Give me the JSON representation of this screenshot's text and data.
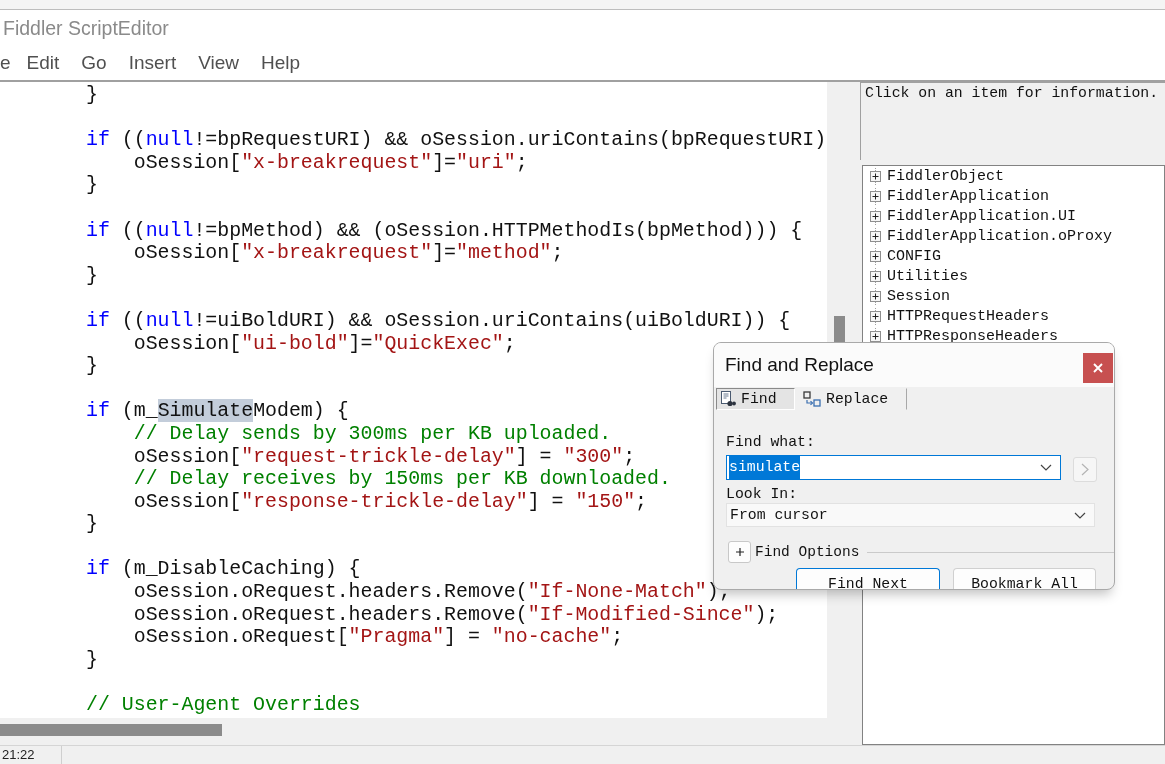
{
  "window": {
    "title": "Fiddler ScriptEditor"
  },
  "menu": [
    "e",
    "Edit",
    "Go",
    "Insert",
    "View",
    "Help"
  ],
  "editor": {
    "blocks": [
      {
        "lines": [
          {
            "tokens": [
              {
                "kind": "plain",
                "text": "}"
              }
            ]
          }
        ]
      },
      {
        "lines": [
          {
            "tokens": [
              {
                "kind": "keyword",
                "text": "if"
              },
              {
                "kind": "plain",
                "text": " (("
              },
              {
                "kind": "keyword",
                "text": "null"
              },
              {
                "kind": "plain",
                "text": "!=bpRequestURI) && oSession.uriContains(bpRequestURI)"
              }
            ],
            "children": [
              {
                "tokens": [
                  {
                    "kind": "plain",
                    "text": "oSession["
                  },
                  {
                    "kind": "string",
                    "text": "\"x-breakrequest\""
                  },
                  {
                    "kind": "plain",
                    "text": "]="
                  },
                  {
                    "kind": "string",
                    "text": "\"uri\""
                  },
                  {
                    "kind": "plain",
                    "text": ";"
                  }
                ]
              }
            ]
          },
          {
            "tokens": [
              {
                "kind": "plain",
                "text": "}"
              }
            ]
          }
        ]
      },
      {
        "lines": [
          {
            "tokens": [
              {
                "kind": "keyword",
                "text": "if"
              },
              {
                "kind": "plain",
                "text": " (("
              },
              {
                "kind": "keyword",
                "text": "null"
              },
              {
                "kind": "plain",
                "text": "!=bpMethod) && (oSession.HTTPMethodIs(bpMethod))) {"
              }
            ],
            "children": [
              {
                "tokens": [
                  {
                    "kind": "plain",
                    "text": "oSession["
                  },
                  {
                    "kind": "string",
                    "text": "\"x-breakrequest\""
                  },
                  {
                    "kind": "plain",
                    "text": "]="
                  },
                  {
                    "kind": "string",
                    "text": "\"method\""
                  },
                  {
                    "kind": "plain",
                    "text": ";"
                  }
                ]
              }
            ]
          },
          {
            "tokens": [
              {
                "kind": "plain",
                "text": "}"
              }
            ]
          }
        ]
      },
      {
        "lines": [
          {
            "tokens": [
              {
                "kind": "keyword",
                "text": "if"
              },
              {
                "kind": "plain",
                "text": " (("
              },
              {
                "kind": "keyword",
                "text": "null"
              },
              {
                "kind": "plain",
                "text": "!=uiBoldURI) && oSession.uriContains(uiBoldURI)) {"
              }
            ],
            "children": [
              {
                "tokens": [
                  {
                    "kind": "plain",
                    "text": "oSession["
                  },
                  {
                    "kind": "string",
                    "text": "\"ui-bold\""
                  },
                  {
                    "kind": "plain",
                    "text": "]="
                  },
                  {
                    "kind": "string",
                    "text": "\"QuickExec\""
                  },
                  {
                    "kind": "plain",
                    "text": ";"
                  }
                ]
              }
            ]
          },
          {
            "tokens": [
              {
                "kind": "plain",
                "text": "}"
              }
            ]
          }
        ]
      },
      {
        "lines": [
          {
            "tokens": [
              {
                "kind": "keyword",
                "text": "if"
              },
              {
                "kind": "plain",
                "text": " (m_"
              },
              {
                "kind": "match",
                "text": "Simulate"
              },
              {
                "kind": "plain",
                "text": "Modem) {"
              }
            ],
            "children": [
              {
                "tokens": [
                  {
                    "kind": "comment",
                    "text": "// Delay sends by 300ms per KB uploaded."
                  }
                ]
              },
              {
                "tokens": [
                  {
                    "kind": "plain",
                    "text": "oSession["
                  },
                  {
                    "kind": "string",
                    "text": "\"request-trickle-delay\""
                  },
                  {
                    "kind": "plain",
                    "text": "] = "
                  },
                  {
                    "kind": "string",
                    "text": "\"300\""
                  },
                  {
                    "kind": "plain",
                    "text": ";"
                  }
                ]
              },
              {
                "tokens": [
                  {
                    "kind": "comment",
                    "text": "// Delay receives by 150ms per KB downloaded."
                  }
                ]
              },
              {
                "tokens": [
                  {
                    "kind": "plain",
                    "text": "oSession["
                  },
                  {
                    "kind": "string",
                    "text": "\"response-trickle-delay\""
                  },
                  {
                    "kind": "plain",
                    "text": "] = "
                  },
                  {
                    "kind": "string",
                    "text": "\"150\""
                  },
                  {
                    "kind": "plain",
                    "text": ";"
                  }
                ]
              }
            ]
          },
          {
            "tokens": [
              {
                "kind": "plain",
                "text": "}"
              }
            ]
          }
        ]
      },
      {
        "lines": [
          {
            "tokens": [
              {
                "kind": "keyword",
                "text": "if"
              },
              {
                "kind": "plain",
                "text": " (m_DisableCaching) {"
              }
            ],
            "children": [
              {
                "tokens": [
                  {
                    "kind": "plain",
                    "text": "oSession.oRequest.headers.Remove("
                  },
                  {
                    "kind": "string",
                    "text": "\"If-None-Match\""
                  },
                  {
                    "kind": "plain",
                    "text": ");"
                  }
                ]
              },
              {
                "tokens": [
                  {
                    "kind": "plain",
                    "text": "oSession.oRequest.headers.Remove("
                  },
                  {
                    "kind": "string",
                    "text": "\"If-Modified-Since\""
                  },
                  {
                    "kind": "plain",
                    "text": ");"
                  }
                ]
              },
              {
                "tokens": [
                  {
                    "kind": "plain",
                    "text": "oSession.oRequest["
                  },
                  {
                    "kind": "string",
                    "text": "\"Pragma\""
                  },
                  {
                    "kind": "plain",
                    "text": "] = "
                  },
                  {
                    "kind": "string",
                    "text": "\"no-cache\""
                  },
                  {
                    "kind": "plain",
                    "text": ";"
                  }
                ]
              }
            ]
          },
          {
            "tokens": [
              {
                "kind": "plain",
                "text": "}"
              }
            ]
          }
        ]
      },
      {
        "lines": [
          {
            "tokens": [
              {
                "kind": "comment",
                "text": "// User-Agent Overrides"
              }
            ]
          }
        ]
      }
    ]
  },
  "info_panel": {
    "text": "Click on an item for information."
  },
  "object_tree": {
    "items": [
      {
        "label": "FiddlerObject",
        "expanded": false
      },
      {
        "label": "FiddlerApplication",
        "expanded": false
      },
      {
        "label": "FiddlerApplication.UI",
        "expanded": false
      },
      {
        "label": "FiddlerApplication.oProxy",
        "expanded": false
      },
      {
        "label": "CONFIG",
        "expanded": false
      },
      {
        "label": "Utilities",
        "expanded": false
      },
      {
        "label": "Session",
        "expanded": false
      },
      {
        "label": "HTTPRequestHeaders",
        "expanded": false
      },
      {
        "label": "HTTPResponseHeaders",
        "expanded": false
      }
    ]
  },
  "find_dialog": {
    "title": "Find and Replace",
    "tabs": [
      {
        "kind": "find",
        "label": "Find",
        "selected": true
      },
      {
        "kind": "replace",
        "label": "Replace",
        "selected": false
      }
    ],
    "find_what": {
      "label": "Find what:",
      "value": "simulate",
      "text_selected": true
    },
    "forward_button": {
      "disabled": true
    },
    "look_in": {
      "label": "Look In:",
      "value": "From cursor"
    },
    "options": {
      "label": "Find Options",
      "expanded": false
    },
    "buttons": [
      {
        "label": "Find Next",
        "default": true
      },
      {
        "label": "Bookmark All",
        "default": false
      }
    ]
  },
  "status_bar": {
    "cursor_position": "21:22"
  }
}
